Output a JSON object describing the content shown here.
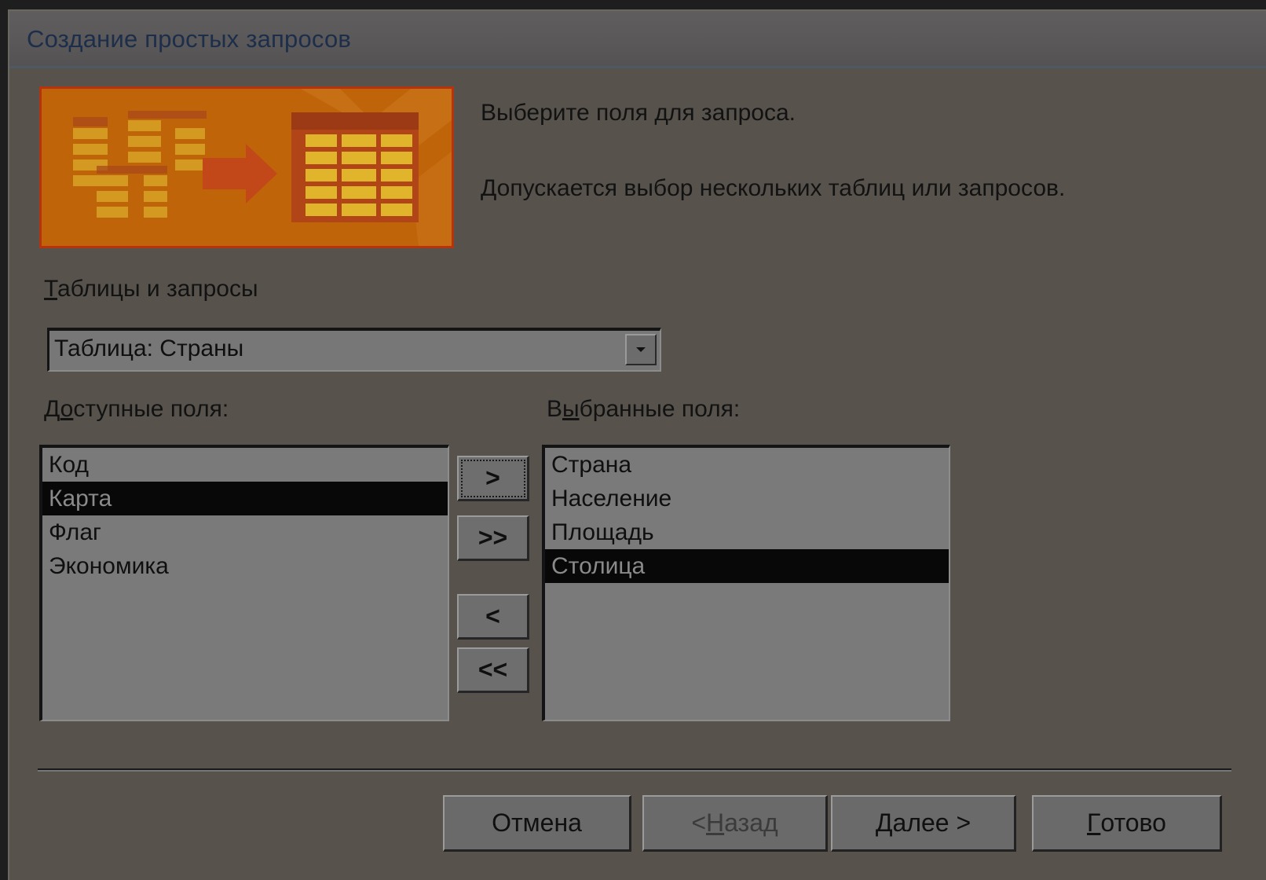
{
  "window": {
    "title": "Создание простых запросов"
  },
  "intro": {
    "line1": "Выберите поля для запроса.",
    "line2": "Допускается выбор нескольких таблиц или запросов."
  },
  "tables_label": {
    "mnemonic": "Т",
    "rest": "аблицы и запросы"
  },
  "table_combo": {
    "value": "Таблица: Страны"
  },
  "available": {
    "label_pre": "Д",
    "label_mnemonic": "о",
    "label_post": "ступные поля:",
    "items": [
      "Код",
      "Карта",
      "Флаг",
      "Экономика"
    ],
    "selected": "Карта"
  },
  "selected_fields": {
    "label_pre": "В",
    "label_mnemonic": "ы",
    "label_post": "бранные поля:",
    "items": [
      "Страна",
      "Население",
      "Площадь",
      "Столица"
    ],
    "selected": "Столица"
  },
  "move_buttons": {
    "add": ">",
    "add_all": ">>",
    "remove": "<",
    "remove_all": "<<"
  },
  "footer": {
    "cancel": "Отмена",
    "back_pre": "< ",
    "back_mnemonic": "Н",
    "back_post": "азад",
    "next_mnemonic": "Д",
    "next_post": "алее >",
    "finish_mnemonic": "Г",
    "finish_post": "отово"
  },
  "colors": {
    "dialog_bg": "#57534c",
    "title_text": "#1c2e4a",
    "wizard_image_bg": "#c0640a",
    "wizard_image_border": "#b5340f",
    "selection_bg": "#080808"
  },
  "icons": {
    "combo_dropdown": "chevron-down-icon",
    "wizard_image": "table-to-query-icon"
  }
}
